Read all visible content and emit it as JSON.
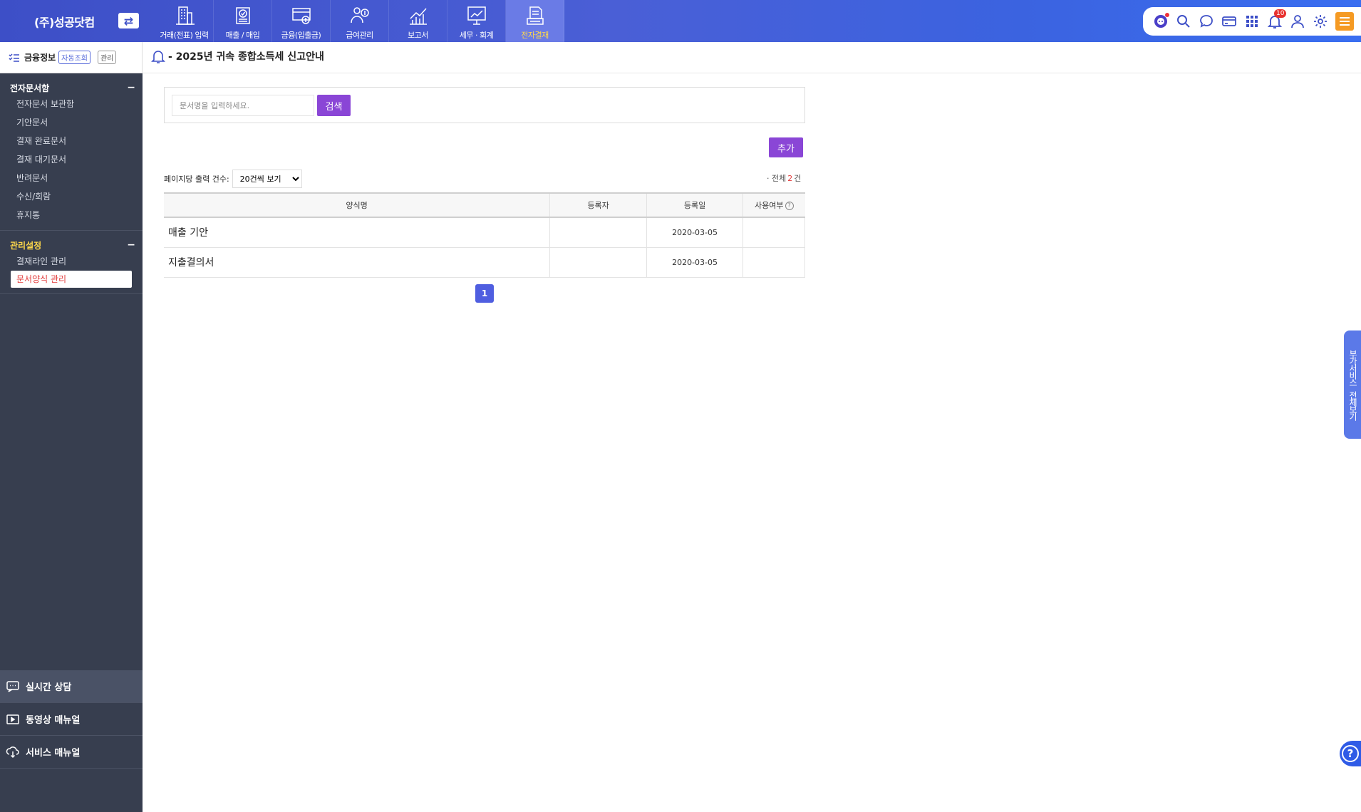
{
  "brand": {
    "name": "(주)성공닷컴",
    "switch_icon": "swap-icon"
  },
  "nav": [
    {
      "label": "거래(전표) 입력",
      "icon": "building-icon"
    },
    {
      "label": "매출 / 매입",
      "icon": "invoice-check-icon"
    },
    {
      "label": "금융(입출금)",
      "icon": "bank-card-icon"
    },
    {
      "label": "급여관리",
      "icon": "payroll-icon"
    },
    {
      "label": "보고서",
      "icon": "chart-icon"
    },
    {
      "label": "세무 · 회계",
      "icon": "presentation-icon"
    },
    {
      "label": "전자결재",
      "icon": "document-stack-icon"
    }
  ],
  "nav_active_index": 6,
  "tools": {
    "notification_count": "10"
  },
  "finance_bar": {
    "title": "금융정보",
    "auto_tag": "자동조회",
    "manage_tag": "관리"
  },
  "sidebar": {
    "sections": [
      {
        "title": "전자문서함",
        "collapse": "−",
        "items": [
          "전자문서 보관함",
          "기안문서",
          "결재 완료문서",
          "결재 대기문서",
          "반려문서",
          "수신/회람",
          "휴지통"
        ]
      },
      {
        "title": "관리설정",
        "collapse": "−",
        "items": [
          "결재라인 관리",
          "문서양식 관리"
        ]
      }
    ],
    "bottom": [
      {
        "label": "실시간 상담",
        "icon": "chat-icon"
      },
      {
        "label": "동영상 매뉴얼",
        "icon": "video-icon"
      },
      {
        "label": "서비스 매뉴얼",
        "icon": "cloud-download-icon"
      }
    ]
  },
  "notice": {
    "text": "- 2025년 귀속 종합소득세 신고안내"
  },
  "search": {
    "placeholder": "문서명을 입력하세요.",
    "button": "검색"
  },
  "add_button": "추가",
  "list": {
    "per_page_label": "페이지당 출력 건수:",
    "per_page_value": "20건씩 보기",
    "total_prefix": "· 전체",
    "total_count": "2",
    "total_suffix": "건",
    "columns": [
      "양식명",
      "등록자",
      "등록일",
      "사용여부"
    ],
    "rows": [
      {
        "name": "매출 기안",
        "author": "",
        "date": "2020-03-05",
        "use": ""
      },
      {
        "name": "지출결의서",
        "author": "",
        "date": "2020-03-05",
        "use": ""
      }
    ],
    "current_page": "1"
  },
  "side_tab": {
    "line1": "부가서비스",
    "line2": "전체보기"
  },
  "colors": {
    "primary": "#3d4fc7",
    "accent": "#8a46d6",
    "active_nav": "#ffd84a",
    "sidebar": "#373e4f"
  }
}
